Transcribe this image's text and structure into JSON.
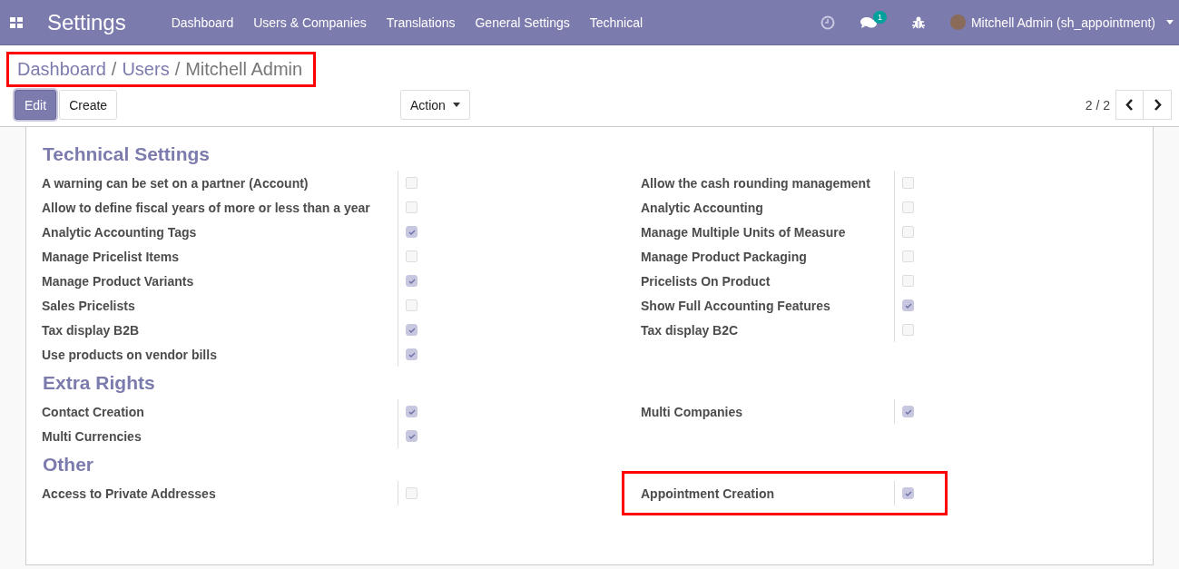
{
  "navbar": {
    "app_title": "Settings",
    "menu": [
      "Dashboard",
      "Users & Companies",
      "Translations",
      "General Settings",
      "Technical"
    ],
    "messages_badge": "1",
    "user": "Mitchell Admin (sh_appointment)"
  },
  "breadcrumb": {
    "highlighted": true,
    "separator": "/",
    "items": [
      "Dashboard",
      "Users",
      "Mitchell Admin"
    ]
  },
  "buttons": {
    "edit": "Edit",
    "create": "Create",
    "action": "Action"
  },
  "pager": "2 / 2",
  "sections": [
    {
      "title": "Technical Settings",
      "columns": [
        [
          {
            "label": "A warning can be set on a partner (Account)",
            "checked": false,
            "highlighted": false
          },
          {
            "label": "Allow to define fiscal years of more or less than a year",
            "checked": false,
            "highlighted": false
          },
          {
            "label": "Analytic Accounting Tags",
            "checked": true,
            "highlighted": false
          },
          {
            "label": "Manage Pricelist Items",
            "checked": false,
            "highlighted": false
          },
          {
            "label": "Manage Product Variants",
            "checked": true,
            "highlighted": false
          },
          {
            "label": "Sales Pricelists",
            "checked": false,
            "highlighted": false
          },
          {
            "label": "Tax display B2B",
            "checked": true,
            "highlighted": false
          },
          {
            "label": "Use products on vendor bills",
            "checked": true,
            "highlighted": false
          }
        ],
        [
          {
            "label": "Allow the cash rounding management",
            "checked": false,
            "highlighted": false
          },
          {
            "label": "Analytic Accounting",
            "checked": false,
            "highlighted": false
          },
          {
            "label": "Manage Multiple Units of Measure",
            "checked": false,
            "highlighted": false
          },
          {
            "label": "Manage Product Packaging",
            "checked": false,
            "highlighted": false
          },
          {
            "label": "Pricelists On Product",
            "checked": false,
            "highlighted": false
          },
          {
            "label": "Show Full Accounting Features",
            "checked": true,
            "highlighted": false
          },
          {
            "label": "Tax display B2C",
            "checked": false,
            "highlighted": false
          }
        ]
      ]
    },
    {
      "title": "Extra Rights",
      "columns": [
        [
          {
            "label": "Contact Creation",
            "checked": true,
            "highlighted": false
          },
          {
            "label": "Multi Currencies",
            "checked": true,
            "highlighted": false
          }
        ],
        [
          {
            "label": "Multi Companies",
            "checked": true,
            "highlighted": false
          }
        ]
      ]
    },
    {
      "title": "Other",
      "columns": [
        [
          {
            "label": "Access to Private Addresses",
            "checked": false,
            "highlighted": false
          }
        ],
        [
          {
            "label": "Appointment Creation",
            "checked": true,
            "highlighted": true
          }
        ]
      ]
    }
  ]
}
